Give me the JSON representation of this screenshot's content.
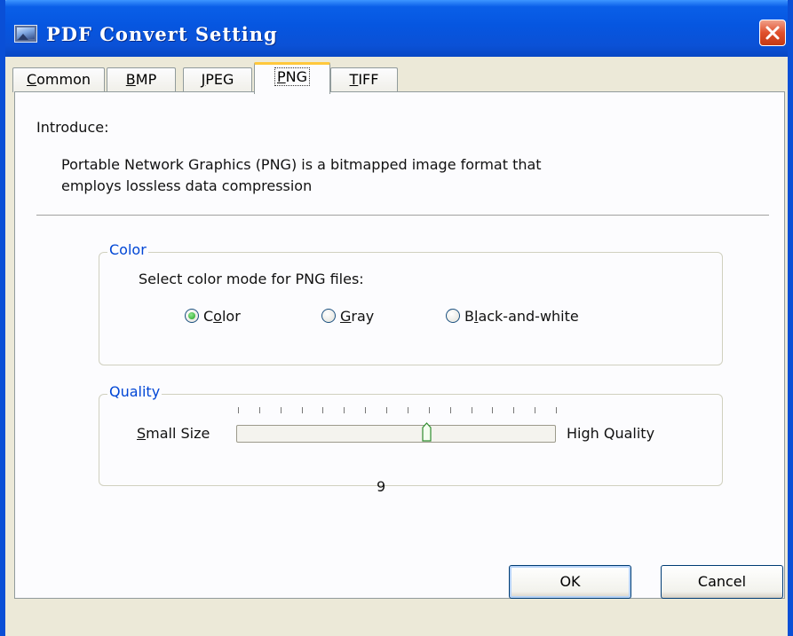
{
  "window": {
    "title": "PDF Convert Setting"
  },
  "tabs": [
    {
      "label": "Common",
      "mnemonic": "C",
      "rest": "ommon"
    },
    {
      "label": "BMP",
      "mnemonic": "B",
      "rest": "MP"
    },
    {
      "label": "JPEG",
      "mnemonic": "J",
      "rest": "PEG"
    },
    {
      "label": "PNG",
      "mnemonic": "P",
      "rest": "NG",
      "active": true
    },
    {
      "label": "TIFF",
      "mnemonic": "T",
      "rest": "IFF"
    }
  ],
  "intro": {
    "label": "Introduce:",
    "line1": "Portable Network Graphics (PNG) is a bitmapped image format that",
    "line2": "employs lossless data compression"
  },
  "color_group": {
    "legend": "Color",
    "prompt": "Select color mode for PNG files:",
    "options": [
      {
        "label": "Color",
        "before": "C",
        "mnemonic": "o",
        "after": "lor",
        "selected": true
      },
      {
        "label": "Gray",
        "before": "",
        "mnemonic": "G",
        "after": "ray",
        "selected": false
      },
      {
        "label": "Black-and-white",
        "before": "B",
        "mnemonic": "l",
        "after": "ack-and-white",
        "selected": false
      }
    ]
  },
  "quality_group": {
    "legend": "Quality",
    "min_label_mnemonic": "S",
    "min_label_rest": "mall Size",
    "max_label": "High Quality",
    "value": 9,
    "value_text": "9",
    "tick_count": 16
  },
  "buttons": {
    "ok": "OK",
    "cancel": "Cancel"
  },
  "colors": {
    "titlebar": "#0a5fe8",
    "legend_text": "#0046d5",
    "active_tab_accent": "#ffc83c",
    "close_button": "#e0502c"
  }
}
